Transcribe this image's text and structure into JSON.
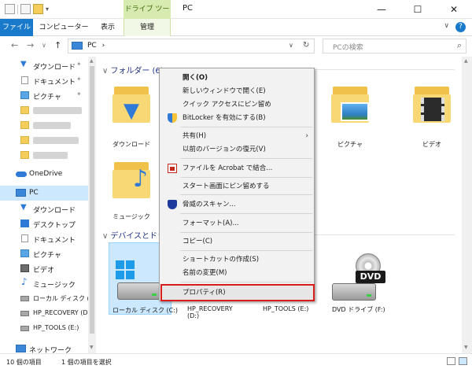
{
  "window": {
    "title": "PC",
    "contextual_tab": "ドライブ ツール",
    "controls": {
      "minimize": "—",
      "maximize": "☐",
      "close": "✕"
    }
  },
  "ribbon": {
    "tabs": [
      "ファイル",
      "コンピューター",
      "表示",
      "管理"
    ],
    "expand": "∨",
    "help": "?"
  },
  "address": {
    "back": "←",
    "forward": "→",
    "recent": "∨",
    "up": "↑",
    "path": "PC",
    "path_sep": "›",
    "dropdown": "∨",
    "refresh": "↻",
    "search_placeholder": "PCの検索",
    "search_icon": "⌕"
  },
  "sidebar": {
    "items": [
      {
        "label": "ダウンロード",
        "icon": "download-icon",
        "pinned": true
      },
      {
        "label": "ドキュメント",
        "icon": "document-icon",
        "pinned": true
      },
      {
        "label": "ピクチャ",
        "icon": "pictures-icon",
        "pinned": true
      },
      {
        "label": "",
        "icon": "folder-icon",
        "blurred": true
      },
      {
        "label": "",
        "icon": "folder-icon",
        "blurred": true
      },
      {
        "label": "",
        "icon": "folder-icon",
        "blurred": true
      },
      {
        "label": "",
        "icon": "folder-icon",
        "blurred": true
      },
      {
        "label": "OneDrive",
        "icon": "onedrive-icon"
      },
      {
        "label": "PC",
        "icon": "pc-icon",
        "selected": true
      },
      {
        "label": "ダウンロード",
        "icon": "download-icon"
      },
      {
        "label": "デスクトップ",
        "icon": "desktop-icon"
      },
      {
        "label": "ドキュメント",
        "icon": "document-icon"
      },
      {
        "label": "ピクチャ",
        "icon": "pictures-icon"
      },
      {
        "label": "ビデオ",
        "icon": "video-icon"
      },
      {
        "label": "ミュージック",
        "icon": "music-icon"
      },
      {
        "label": "ローカル ディスク (C:)",
        "icon": "drive-icon"
      },
      {
        "label": "HP_RECOVERY (D:)",
        "icon": "drive-icon"
      },
      {
        "label": "HP_TOOLS (E:)",
        "icon": "drive-icon"
      },
      {
        "label": "ネットワーク",
        "icon": "network-icon"
      }
    ],
    "pin_glyph": "📌"
  },
  "content": {
    "folders_header": "フォルダー (6)",
    "devices_header": "デバイスとドライブ",
    "folders": [
      {
        "label": "ダウンロード",
        "emblem": "download-icon"
      },
      {
        "label": "ピクチャ",
        "emblem": "pictures-icon"
      },
      {
        "label": "ビデオ",
        "emblem": "video-icon"
      },
      {
        "label": "ミュージック",
        "emblem": "music-icon"
      }
    ],
    "drives": [
      {
        "label": "ローカル ディスク (C:)"
      },
      {
        "label": "HP_RECOVERY (D:)"
      },
      {
        "label": "HP_TOOLS (E:)"
      },
      {
        "label": "DVD ドライブ (F:)"
      }
    ],
    "dvd_badge": "DVD"
  },
  "context_menu": {
    "items": [
      {
        "label": "開く(O)",
        "bold": true
      },
      {
        "label": "新しいウィンドウで開く(E)"
      },
      {
        "label": "クイック アクセスにピン留め"
      },
      {
        "label": "BitLocker を有効にする(B)",
        "icon": "bitlocker-shield-icon"
      },
      {
        "label": "共有(H)",
        "submenu": true
      },
      {
        "label": "以前のバージョンの復元(V)"
      },
      {
        "label": "ファイルを Acrobat で結合...",
        "icon": "acrobat-icon"
      },
      {
        "label": "スタート画面にピン留めする"
      },
      {
        "label": "脅威のスキャン...",
        "icon": "defender-icon"
      },
      {
        "label": "フォーマット(A)..."
      },
      {
        "label": "コピー(C)"
      },
      {
        "label": "ショートカットの作成(S)"
      },
      {
        "label": "名前の変更(M)"
      },
      {
        "label": "プロパティ(R)",
        "highlighted": true
      }
    ],
    "submenu_arrow": "›"
  },
  "status": {
    "item_count": "10 個の項目",
    "selected": "1 個の項目を選択"
  }
}
